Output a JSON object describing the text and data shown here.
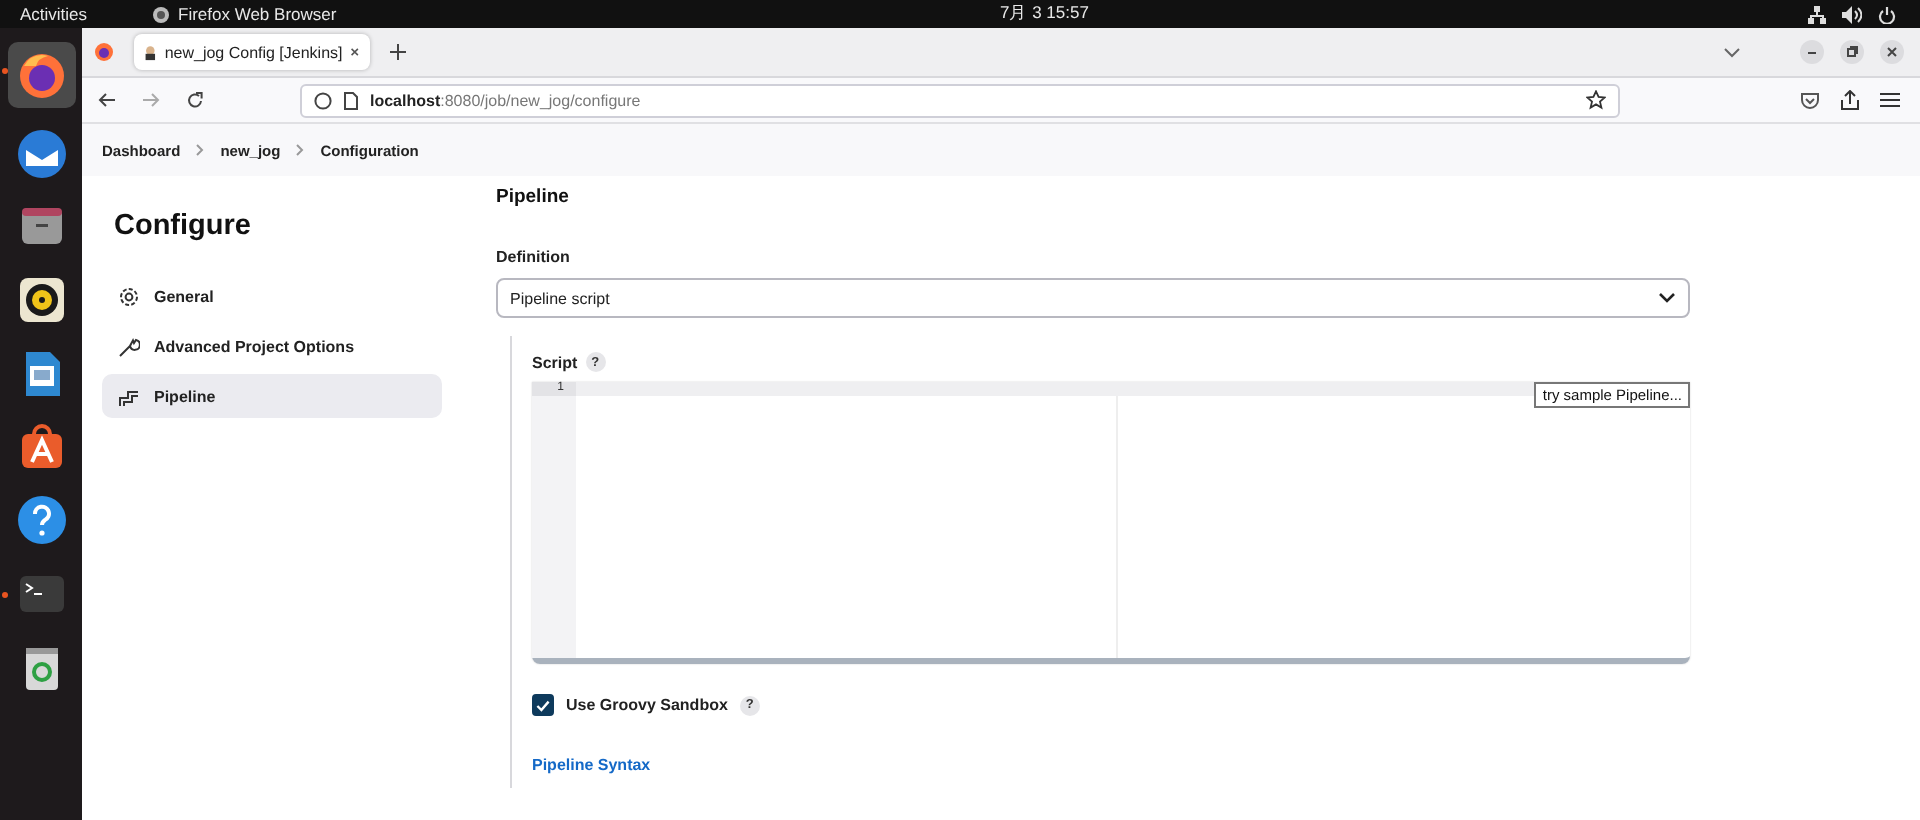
{
  "top_bar": {
    "activities": "Activities",
    "app": "Firefox Web Browser",
    "clock": "7月 3  15:57"
  },
  "dock": {
    "items": [
      {
        "kind": "firefox",
        "running": true
      },
      {
        "kind": "mail",
        "running": false
      },
      {
        "kind": "files",
        "running": false
      },
      {
        "kind": "music",
        "running": false
      },
      {
        "kind": "writer",
        "running": false
      },
      {
        "kind": "store",
        "running": false
      },
      {
        "kind": "help",
        "running": false
      },
      {
        "kind": "terminal",
        "running": true
      },
      {
        "kind": "trash",
        "running": false
      }
    ]
  },
  "browser": {
    "tabs": [
      {
        "title": "new_jog Config [Jenkins]",
        "selected": true
      }
    ],
    "url": "**localhost**:8080/job/new_jog/configure"
  },
  "breadcrumbs": [
    "Dashboard",
    "new_jog",
    "Configuration"
  ],
  "sidebar": {
    "title": "Configure",
    "items": [
      {
        "label": "General",
        "kind": "gear",
        "selected": false
      },
      {
        "label": "Advanced Project Options",
        "kind": "wrench",
        "selected": false
      },
      {
        "label": "Pipeline",
        "kind": "pipe",
        "selected": true
      }
    ]
  },
  "pipeline": {
    "heading": "Pipeline",
    "definition_label": "Definition",
    "definition_value": "Pipeline script",
    "script_label": "Script",
    "script_help": "?",
    "line_numbers": [
      "1"
    ],
    "sample_select": "try sample Pipeline...",
    "sandbox": {
      "label": "Use Groovy Sandbox",
      "checked": true,
      "help": "?"
    },
    "syntax_link": "Pipeline Syntax"
  }
}
